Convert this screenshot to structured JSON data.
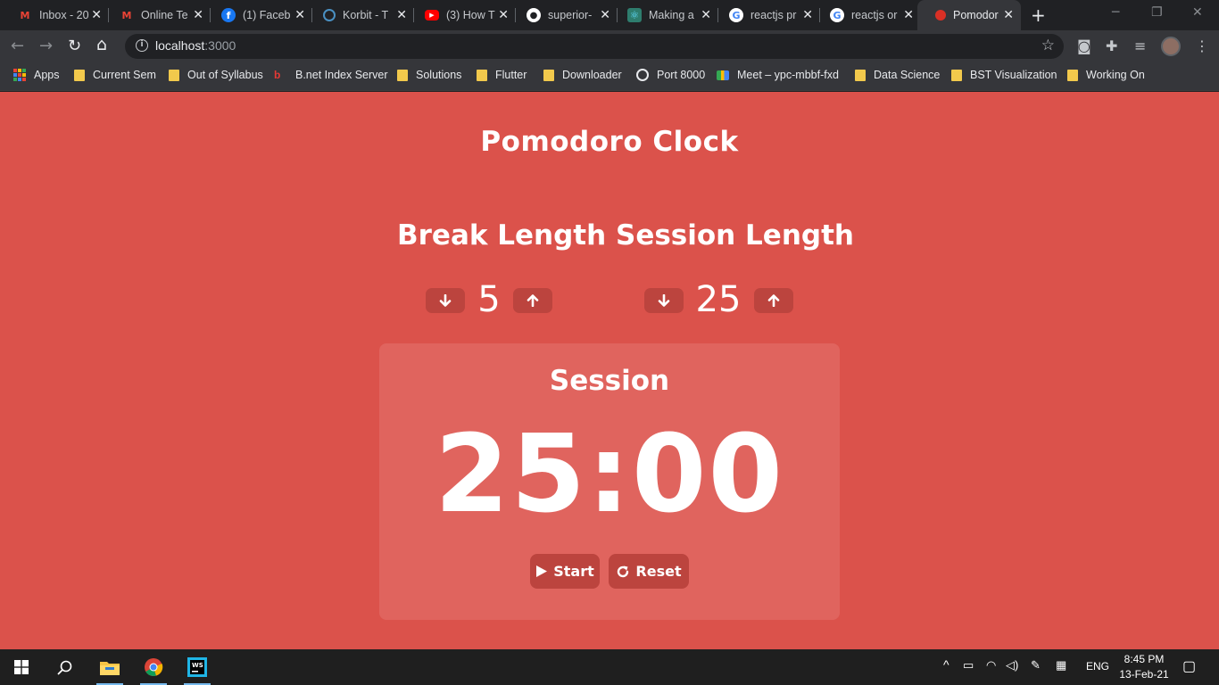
{
  "browser": {
    "tabs": [
      {
        "title": "Inbox - 20",
        "icon": "gmail-icon",
        "active": false
      },
      {
        "title": "Online Te",
        "icon": "gmail-icon",
        "active": false
      },
      {
        "title": "(1) Faceb",
        "icon": "facebook-icon",
        "active": false
      },
      {
        "title": "Korbit - T",
        "icon": "korbit-icon",
        "active": false
      },
      {
        "title": "(3) How T",
        "icon": "youtube-icon",
        "active": false
      },
      {
        "title": "superior-",
        "icon": "github-icon",
        "active": false
      },
      {
        "title": "Making a",
        "icon": "react-icon",
        "active": false
      },
      {
        "title": "reactjs pr",
        "icon": "google-icon",
        "active": false
      },
      {
        "title": "reactjs or",
        "icon": "google-icon",
        "active": false
      },
      {
        "title": "Pomodor",
        "icon": "tomato-icon",
        "active": true
      }
    ],
    "url_host": "localhost",
    "url_port": ":3000",
    "bookmarks": [
      {
        "label": "Apps",
        "icon": "apps-grid-icon"
      },
      {
        "label": "Current Sem",
        "icon": "folder-icon"
      },
      {
        "label": "Out of Syllabus",
        "icon": "folder-icon"
      },
      {
        "label": "B.net Index Server",
        "icon": "bnet-icon"
      },
      {
        "label": "Solutions",
        "icon": "folder-icon"
      },
      {
        "label": "Flutter",
        "icon": "folder-icon"
      },
      {
        "label": "Downloader",
        "icon": "folder-icon"
      },
      {
        "label": "Port 8000",
        "icon": "globe-icon"
      },
      {
        "label": "Meet – ypc-mbbf-fxd",
        "icon": "meet-icon"
      },
      {
        "label": "Data Science",
        "icon": "folder-icon"
      },
      {
        "label": "BST Visualization",
        "icon": "folder-icon"
      },
      {
        "label": "Working On",
        "icon": "folder-icon"
      }
    ]
  },
  "app": {
    "title": "Pomodoro Clock",
    "background_color": "#db524b",
    "break": {
      "label": "Break Length",
      "value": "5"
    },
    "session": {
      "label": "Session Length",
      "value": "25"
    },
    "timer": {
      "label": "Session",
      "display": "25:00"
    },
    "controls": {
      "start": "Start",
      "reset": "Reset"
    }
  },
  "taskbar": {
    "language": "ENG",
    "time": "8:45 PM",
    "date": "13-Feb-21"
  }
}
